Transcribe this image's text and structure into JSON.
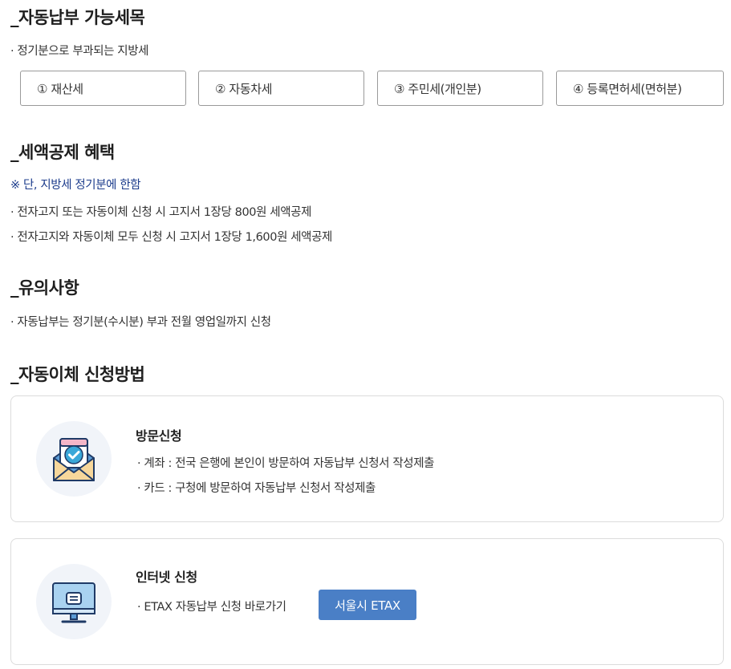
{
  "sections": {
    "items": {
      "title": "_자동납부 가능세목",
      "desc": "· 정기분으로 부과되는 지방세",
      "taxes": [
        "① 재산세",
        "② 자동차세",
        "③ 주민세(개인분)",
        "④ 등록면허세(면허분)"
      ]
    },
    "benefit": {
      "title": "_세액공제 혜택",
      "note": "※ 단, 지방세 정기분에 한함",
      "lines": [
        "· 전자고지 또는 자동이체 신청 시 고지서 1장당 800원 세액공제",
        "· 전자고지와 자동이체 모두 신청 시 고지서 1장당 1,600원 세액공제"
      ]
    },
    "caution": {
      "title": "_유의사항",
      "lines": [
        "· 자동납부는 정기분(수시분) 부과 전월 영업일까지 신청"
      ]
    },
    "method": {
      "title": "_자동이체 신청방법",
      "visit": {
        "title": "방문신청",
        "lines": [
          "· 계좌 : 전국 은행에 본인이 방문하여 자동납부 신청서 작성제출",
          "· 카드 : 구청에 방문하여 자동납부 신청서 작성제출"
        ],
        "icon": "envelope-check-icon"
      },
      "internet": {
        "title": "인터넷 신청",
        "line": "· ETAX 자동납부 신청 바로가기",
        "button": "서울시 ETAX",
        "icon": "monitor-icon"
      }
    }
  },
  "colors": {
    "note": "#1c3c8c",
    "button": "#4a7fc6",
    "icon_bg": "#f1f4f9",
    "envelope_front": "#5b9bd5",
    "envelope_flap": "#f7d79b",
    "card_letter": "#f4b6c8",
    "check_badge": "#3aa7d8",
    "monitor_screen": "#a9d2f0"
  }
}
